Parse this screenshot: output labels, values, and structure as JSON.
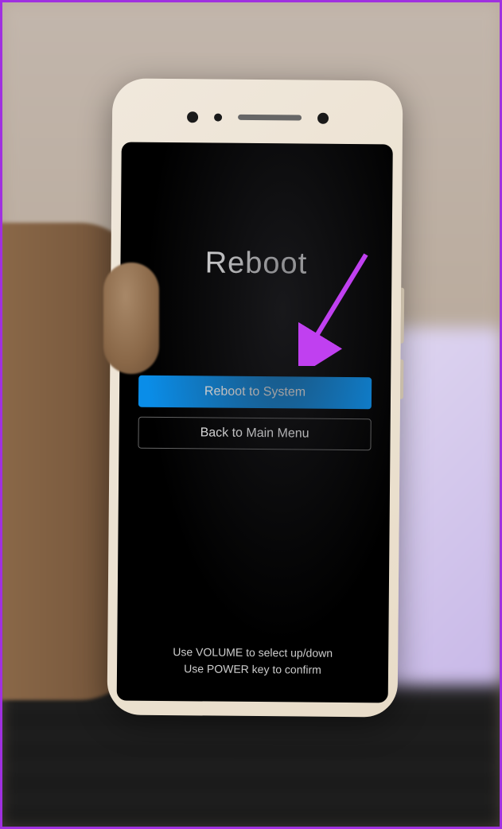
{
  "annotation": {
    "description": "Arrow pointing to Reboot to System option",
    "color": "#c040f0"
  },
  "phone_screen": {
    "title": "Reboot",
    "menu": {
      "options": [
        {
          "label": "Reboot to System",
          "selected": true
        },
        {
          "label": "Back to Main Menu",
          "selected": false
        }
      ]
    },
    "instructions": {
      "line1": "Use VOLUME to select up/down",
      "line2": "Use POWER key to confirm"
    }
  }
}
